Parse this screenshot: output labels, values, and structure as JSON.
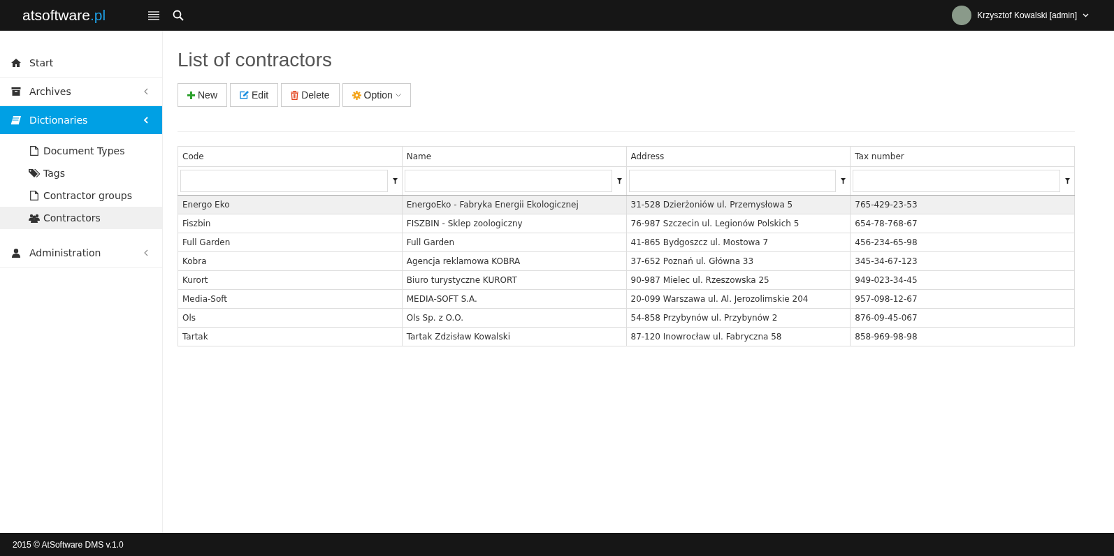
{
  "header": {
    "logo": {
      "name": "atsoftware",
      "suffix": ".pl"
    },
    "user": {
      "name": "Krzysztof Kowalski [admin]"
    }
  },
  "sidebar": {
    "items": [
      {
        "label": "Start",
        "selected": false
      },
      {
        "label": "Archives",
        "selected": false,
        "expanded": false
      },
      {
        "label": "Dictionaries",
        "selected": true,
        "expanded": true,
        "children": [
          {
            "label": "Document Types",
            "selected": false
          },
          {
            "label": "Tags",
            "selected": false
          },
          {
            "label": "Contractor groups",
            "selected": false
          },
          {
            "label": "Contractors",
            "selected": true
          }
        ]
      },
      {
        "label": "Administration",
        "selected": false,
        "expanded": false
      }
    ]
  },
  "page": {
    "title": "List of contractors",
    "toolbar": [
      {
        "kind": "new",
        "label": "New"
      },
      {
        "kind": "edit",
        "label": "Edit"
      },
      {
        "kind": "delete",
        "label": "Delete"
      },
      {
        "kind": "option",
        "label": "Option"
      }
    ],
    "table": {
      "columns": [
        "Code",
        "Name",
        "Address",
        "Tax number"
      ],
      "rows": [
        {
          "selected": true,
          "cells": [
            "Energo Eko",
            "EnergoEko - Fabryka Energii Ekologicznej",
            "31-528 Dzierżoniów ul. Przemysłowa 5",
            "765-429-23-53"
          ]
        },
        {
          "selected": false,
          "cells": [
            "Fiszbin",
            "FISZBIN - Sklep zoologiczny",
            "76-987 Szczecin ul. Legionów Polskich 5",
            "654-78-768-67"
          ]
        },
        {
          "selected": false,
          "cells": [
            "Full Garden",
            "Full Garden",
            "41-865 Bydgoszcz ul. Mostowa 7",
            "456-234-65-98"
          ]
        },
        {
          "selected": false,
          "cells": [
            "Kobra",
            "Agencja reklamowa KOBRA",
            "37-652 Poznań ul. Główna 33",
            "345-34-67-123"
          ]
        },
        {
          "selected": false,
          "cells": [
            "Kurort",
            "Biuro turystyczne KURORT",
            "90-987 Mielec ul. Rzeszowska 25",
            "949-023-34-45"
          ]
        },
        {
          "selected": false,
          "cells": [
            "Media-Soft",
            "MEDIA-SOFT S.A.",
            "20-099 Warszawa ul. Al. Jerozolimskie 204",
            "957-098-12-67"
          ]
        },
        {
          "selected": false,
          "cells": [
            "Ols",
            "Ols Sp. z O.O.",
            "54-858 Przybynów ul. Przybynów 2",
            "876-09-45-067"
          ]
        },
        {
          "selected": false,
          "cells": [
            "Tartak",
            "Tartak Zdzisław Kowalski",
            "87-120 Inowrocław ul. Fabryczna 58",
            "858-969-98-98"
          ]
        }
      ]
    }
  },
  "footer": {
    "text": "2015 © AtSoftware DMS v.1.0"
  }
}
